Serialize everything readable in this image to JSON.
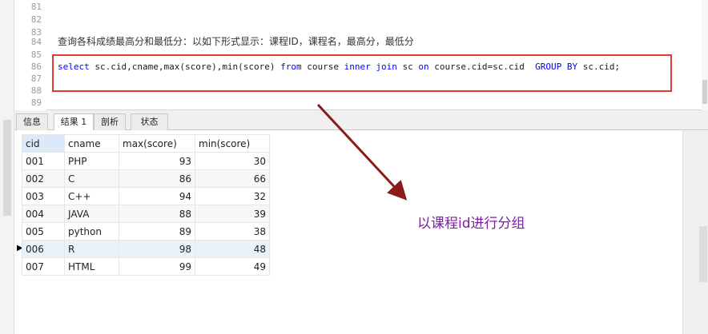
{
  "editor": {
    "lines": [
      {
        "num": "81",
        "text": ""
      },
      {
        "num": "82",
        "text": ""
      },
      {
        "num": "83",
        "text": ""
      },
      {
        "num": "84",
        "text": "查询各科成绩最高分和最低分：以如下形式显示：课程ID，课程名，最高分，最低分"
      },
      {
        "num": "85",
        "text": ""
      },
      {
        "num": "86",
        "text": ""
      },
      {
        "num": "87",
        "text": ""
      },
      {
        "num": "88",
        "text": ""
      },
      {
        "num": "89",
        "text": ""
      }
    ],
    "query_parts": [
      {
        "t": "select",
        "kw": true
      },
      {
        "t": " sc.cid,cname,max(score),min(score) ",
        "kw": false
      },
      {
        "t": "from",
        "kw": true
      },
      {
        "t": " course ",
        "kw": false
      },
      {
        "t": "inner join",
        "kw": true
      },
      {
        "t": " sc ",
        "kw": false
      },
      {
        "t": "on",
        "kw": true
      },
      {
        "t": " course.cid=sc.cid  ",
        "kw": false
      },
      {
        "t": "GROUP BY",
        "kw": true
      },
      {
        "t": " sc.cid;",
        "kw": false
      }
    ]
  },
  "tabs": [
    {
      "label": "信息"
    },
    {
      "label": "结果 1"
    },
    {
      "label": "剖析"
    },
    {
      "label": "状态"
    }
  ],
  "result": {
    "columns": [
      "cid",
      "cname",
      "max(score)",
      "min(score)"
    ],
    "rows": [
      [
        "001",
        "PHP",
        "93",
        "30"
      ],
      [
        "002",
        "C",
        "86",
        "66"
      ],
      [
        "003",
        "C++",
        "94",
        "32"
      ],
      [
        "004",
        "JAVA",
        "88",
        "39"
      ],
      [
        "005",
        "python",
        "89",
        "38"
      ],
      [
        "006",
        "R",
        "98",
        "48"
      ],
      [
        "007",
        "HTML",
        "99",
        "49"
      ]
    ],
    "current_row_marker": "▶"
  },
  "annotation": {
    "text": "以课程id进行分组"
  },
  "colors": {
    "keyword": "#0000ff",
    "highlight_box": "#e53935",
    "arrow": "#8b1a1a",
    "annotation": "#7b1fa2"
  }
}
